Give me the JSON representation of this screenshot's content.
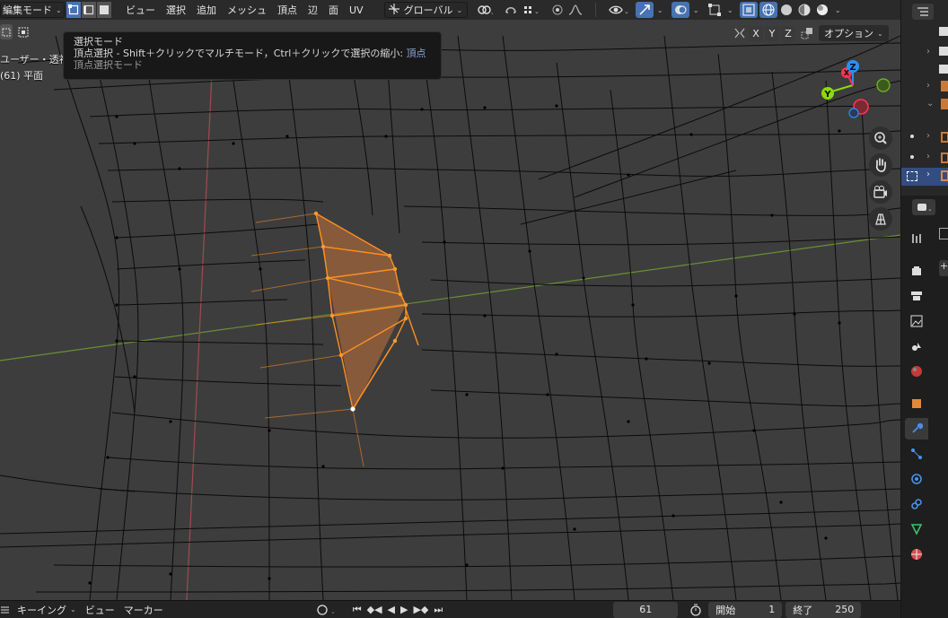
{
  "header": {
    "mode_label": "編集モード",
    "menu": [
      "ビュー",
      "選択",
      "追加",
      "メッシュ",
      "頂点",
      "辺",
      "面",
      "UV"
    ],
    "transform_orientation": "グローバル"
  },
  "overlay": {
    "axes": [
      "X",
      "Y",
      "Z"
    ],
    "options_label": "オプション"
  },
  "view_info": {
    "line1": "ユーザー・透視",
    "line2": "(61) 平面"
  },
  "tooltip": {
    "title": "選択モード",
    "body": "頂点選択 - Shift＋クリックでマルチモード，Ctrl＋クリックで選択の縮小:",
    "body_key": "頂点",
    "python": "頂点選択モード"
  },
  "gizmo": {
    "x": "X",
    "y": "Y",
    "z": "Z"
  },
  "timeline": {
    "keying_label": "キーイング",
    "view_label": "ビュー",
    "marker_label": "マーカー",
    "current_frame": "61",
    "start_label": "開始",
    "start_frame": "1",
    "end_label": "終了",
    "end_frame": "250"
  },
  "icons": {
    "colors": {
      "accent": "#4772b3",
      "selection": "#ff8f1f",
      "x_axis": "#ff3352",
      "y_axis": "#8bdc00",
      "z_axis": "#2890ff"
    }
  }
}
